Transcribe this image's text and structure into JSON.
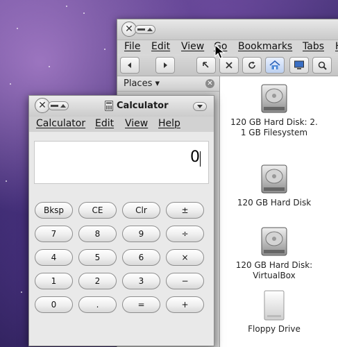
{
  "file_manager": {
    "menus": [
      "File",
      "Edit",
      "View",
      "Go",
      "Bookmarks",
      "Tabs",
      "H"
    ],
    "toolbar_icons": [
      "back-icon",
      "forward-icon",
      "up-icon",
      "stop-icon",
      "reload-icon",
      "home-icon",
      "computer-icon",
      "search-icon"
    ],
    "places": {
      "label": "Places ▾"
    },
    "drives": [
      {
        "label": "120 GB Hard Disk: 2.\n1 GB Filesystem",
        "icon": "hard-disk-icon"
      },
      {
        "label": "120 GB Hard Disk",
        "icon": "hard-disk-icon"
      },
      {
        "label": "120 GB Hard Disk:\nVirtualBox",
        "icon": "hard-disk-icon"
      },
      {
        "label": "Floppy Drive",
        "icon": "floppy-drive-icon"
      }
    ]
  },
  "calculator": {
    "title": "Calculator",
    "menus": [
      "Calculator",
      "Edit",
      "View",
      "Help"
    ],
    "display_value": "0",
    "keys": [
      [
        "Bksp",
        "CE",
        "Clr",
        "±"
      ],
      [
        "7",
        "8",
        "9",
        "÷"
      ],
      [
        "4",
        "5",
        "6",
        "×"
      ],
      [
        "1",
        "2",
        "3",
        "−"
      ],
      [
        "0",
        ".",
        "=",
        "+"
      ]
    ]
  }
}
